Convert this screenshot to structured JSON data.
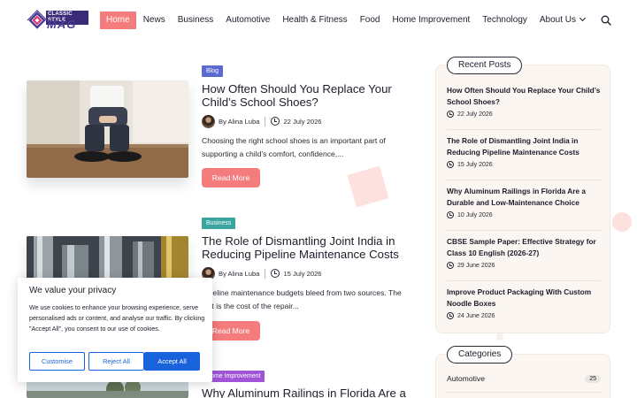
{
  "logo": {
    "top_text": "CLASSIC STYLE",
    "main_text": "MAG"
  },
  "nav": {
    "items": [
      "Home",
      "News",
      "Business",
      "Automotive",
      "Health & Fitness",
      "Food",
      "Home Improvement",
      "Technology",
      "About Us"
    ],
    "active": "Home"
  },
  "icons": {
    "search": "search-icon",
    "clock": "clock-icon",
    "chevron": "chevron-down-icon"
  },
  "colors": {
    "accent": "#f47c7c",
    "blog_tag": "#5b6ad0",
    "business_tag": "#3aa4a0",
    "home_improvement_tag": "#a055d8",
    "cookie_blue": "#1863dc"
  },
  "posts": [
    {
      "category": "Blog",
      "title": "How Often Should You Replace Your Child’s School Shoes?",
      "author": "By Alina Luba",
      "date": "22 July 2026",
      "excerpt": "Choosing the right school shoes is an important part of supporting a child’s comfort, confidence,...",
      "button": "Read More"
    },
    {
      "category": "Business",
      "title": "The Role of Dismantling Joint India in Reducing Pipeline Maintenance Costs",
      "author": "By Alina Luba",
      "date": "15 July 2026",
      "excerpt": "Pipeline maintenance budgets bleed from two sources. The first is the cost of the repair...",
      "button": "Read More"
    },
    {
      "category": "Home Improvement",
      "title": "Why Aluminum Railings in Florida Are a"
    }
  ],
  "sidebar": {
    "recent_title": "Recent Posts",
    "recent_posts": [
      {
        "title": "How Often Should You Replace Your Child’s School Shoes?",
        "date": "22 July 2026"
      },
      {
        "title": "The Role of Dismantling Joint India in Reducing Pipeline Maintenance Costs",
        "date": "15 July 2026"
      },
      {
        "title": "Why Aluminum Railings in Florida Are a Durable and Low-Maintenance Choice",
        "date": "10 July 2026"
      },
      {
        "title": "CBSE Sample Paper: Effective Strategy for Class 10 English (2026-27)",
        "date": "29 June 2026"
      },
      {
        "title": "Improve Product Packaging With Custom Noodle Boxes",
        "date": "24 June 2026"
      }
    ],
    "categories_title": "Categories",
    "categories": [
      {
        "name": "Automotive",
        "count": "25"
      }
    ]
  },
  "cookie": {
    "title": "We value your privacy",
    "text": "We use cookies to enhance your browsing experience, serve personalised ads or content, and analyse our traffic. By clicking \"Accept All\", you consent to our use of cookies.",
    "customise": "Customise",
    "reject": "Reject All",
    "accept": "Accept All"
  }
}
